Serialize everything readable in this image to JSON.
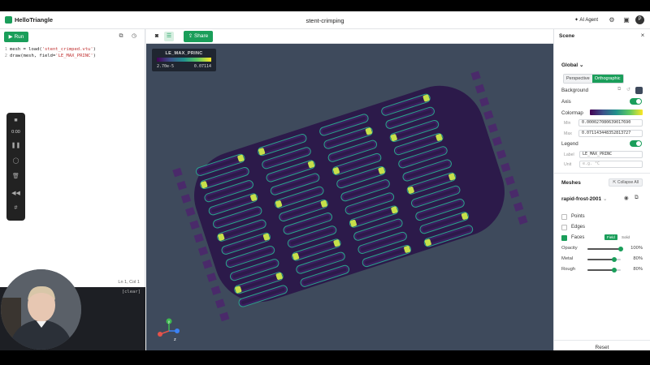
{
  "app": {
    "name": "HelloTriangle",
    "title": "stent-crimping",
    "agent_label": "AI Agent",
    "avatar_letter": "P"
  },
  "editor": {
    "run_label": "Run",
    "lines": [
      {
        "num": "1",
        "pre": "mesh = load(",
        "str": "'stent_crimped.vtu'",
        "post": ")"
      },
      {
        "num": "2",
        "pre": "draw(mesh, field=",
        "str": "'LE_MAX_PRINC'",
        "post": ")"
      }
    ],
    "status": "Ln 1, Col 1"
  },
  "media": {
    "time": "0:00"
  },
  "console": {
    "clear_label": "[clear]"
  },
  "viewport": {
    "share_label": "Share",
    "colorbar": {
      "title": "LE_MAX_PRINC",
      "min": "2.70e-5",
      "max": "0.07114"
    },
    "axes": {
      "x": "x",
      "y": "y",
      "z": "z"
    },
    "colors": {
      "background": "#3e4a5c",
      "strut": "#3b1e5f",
      "hot": "#c6e04a",
      "warm": "#2aa38a"
    }
  },
  "scene": {
    "header": "Scene",
    "global_label": "Global",
    "projection": {
      "perspective": "Perspective",
      "orthographic": "Orthographic"
    },
    "background_label": "Background",
    "axis_label": "Axis",
    "colormap_label": "Colormap",
    "min_label": "Min",
    "min_value": "0.000027080639017690",
    "max_label": "Max",
    "max_value": "0.071143448352813727",
    "legend_label": "Legend",
    "legend_field_label": "Label",
    "legend_field_value": "LE_MAX_PRINC",
    "unit_label": "Unit",
    "unit_placeholder": "e.g. °C",
    "meshes_label": "Meshes",
    "collapse_all": "Collapse All",
    "mesh_name": "rapid-frost-2001",
    "points_label": "Points",
    "edges_label": "Edges",
    "faces_label": "Faces",
    "faces_modes": [
      "Field",
      "Solid"
    ],
    "opacity_label": "Opacity",
    "opacity_value": "100%",
    "opacity": 1.0,
    "metal_label": "Metal",
    "metal_value": "80%",
    "metal": 0.8,
    "rough_label": "Rough",
    "rough_value": "80%",
    "rough": 0.8,
    "reset_label": "Reset"
  }
}
